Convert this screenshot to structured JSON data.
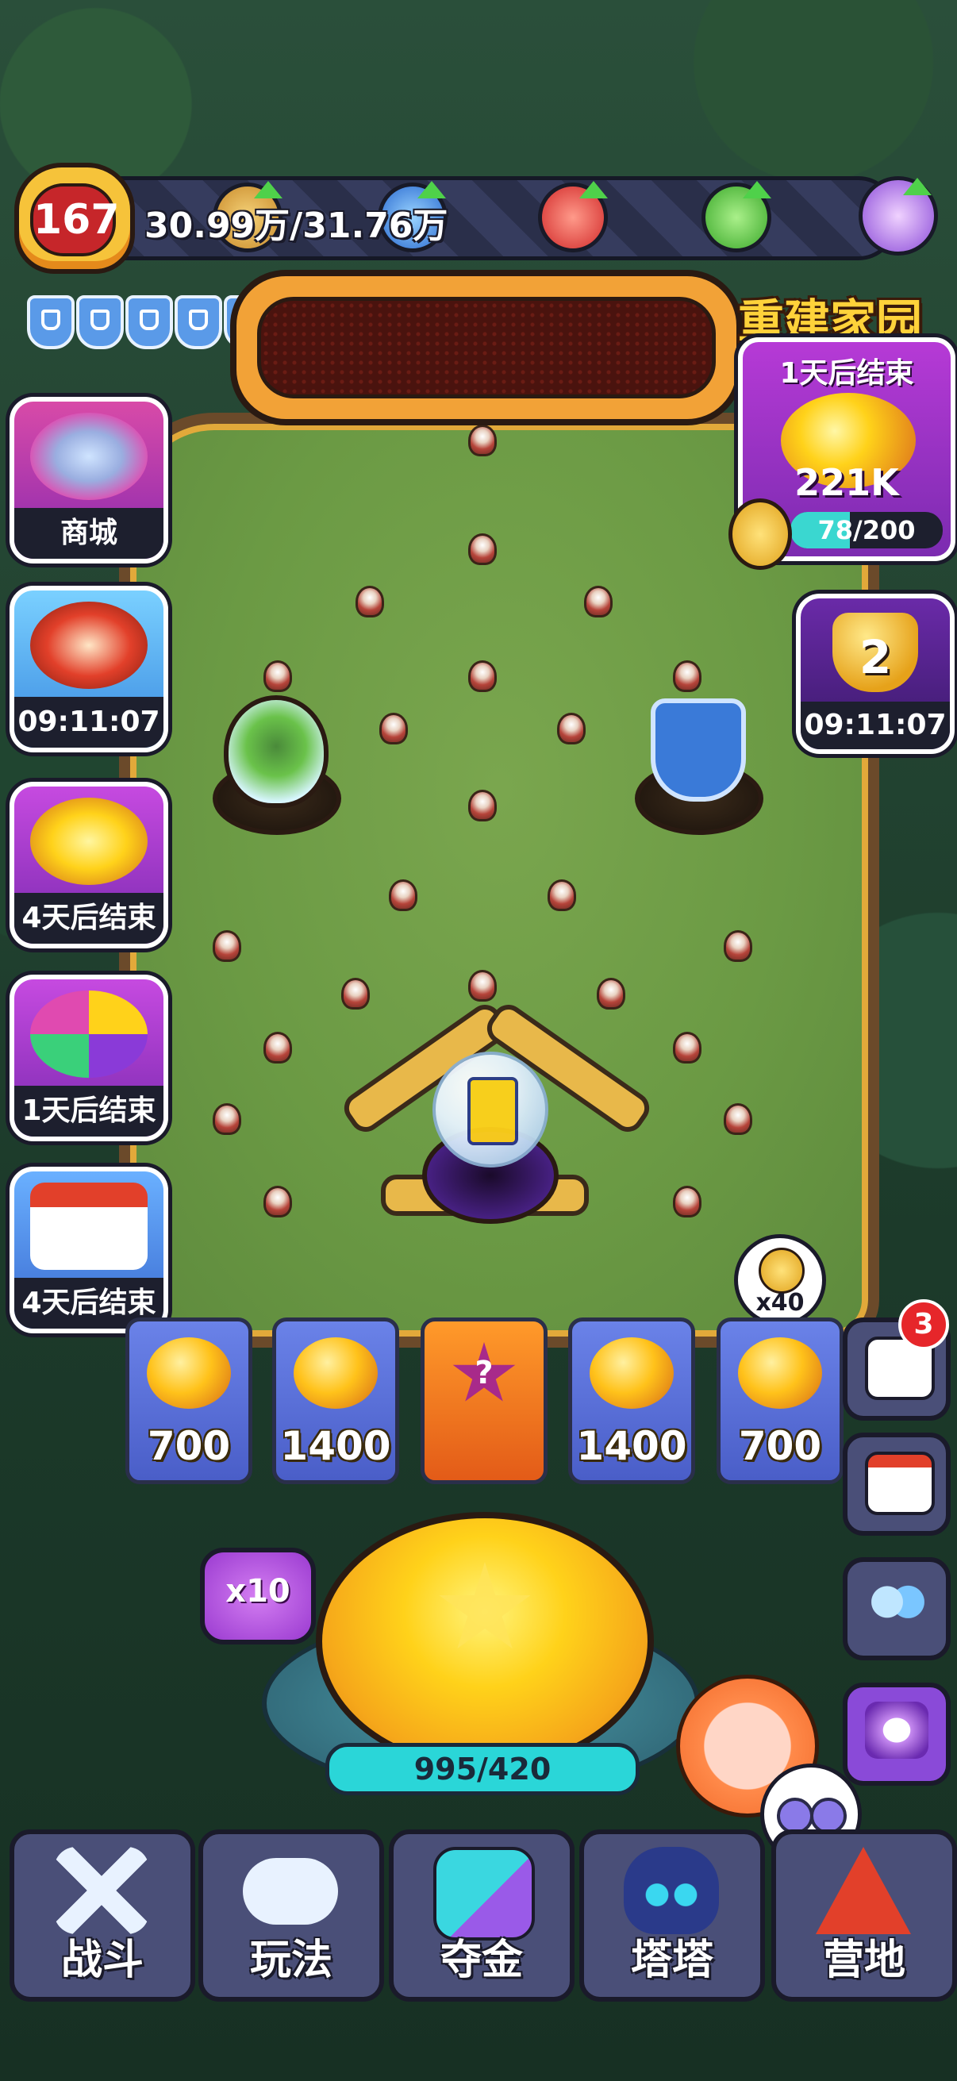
{
  "player": {
    "level": "167"
  },
  "resources": {
    "text": "30.99万/31.76万",
    "icons": [
      "gold-coin-icon",
      "blue-gem-icon",
      "red-fire-icon",
      "green-leaf-icon",
      "purple-orb-icon"
    ],
    "upgrade_arrow_color": "#4fd14a"
  },
  "shields": {
    "count": 5,
    "icon": "shield-icon",
    "color": "#5a9ae8"
  },
  "marquee": {
    "text": ""
  },
  "rebuild_event": {
    "title": "重建家园",
    "timer": "1天后结束",
    "reward": "221K",
    "progress_text": "78/200",
    "progress": 0.39
  },
  "trophy_event": {
    "count": "2",
    "timer": "09:11:07"
  },
  "left_events": [
    {
      "label": "商城",
      "icon": "shop-basket-icon"
    },
    {
      "label": "09:11:07",
      "icon": "red-bird-icon"
    },
    {
      "label": "4天后结束",
      "icon": "gold-cat-icon"
    },
    {
      "label": "1天后结束",
      "icon": "wheel-icon"
    },
    {
      "label": "4天后结束",
      "icon": "calendar-7-icon"
    }
  ],
  "prize_slots": [
    {
      "value": "700",
      "icon": "gold-pile-icon"
    },
    {
      "value": "1400",
      "icon": "gold-pile-icon"
    },
    {
      "value": "",
      "icon": "mystery-star-icon"
    },
    {
      "value": "1400",
      "icon": "gold-pile-icon"
    },
    {
      "value": "700",
      "icon": "gold-pile-icon"
    }
  ],
  "multiplier_bubble": {
    "text": "x40"
  },
  "chat": {
    "badge": "3"
  },
  "launcher": {
    "multiplier": "x10",
    "energy": "995/420"
  },
  "nav": [
    {
      "label": "战斗",
      "icon": "crossed-swords-icon"
    },
    {
      "label": "玩法",
      "icon": "gamepad-icon"
    },
    {
      "label": "夺金",
      "icon": "dice-cube-icon"
    },
    {
      "label": "塔塔",
      "icon": "cat-mascot-icon"
    },
    {
      "label": "营地",
      "icon": "tent-icon"
    }
  ],
  "colors": {
    "field_green": "#6b9a44",
    "gold": "#ffd21a",
    "panel_purple": "#7b2bb0",
    "nav_bg": "#4a4f78",
    "energy_bar": "#2ad6d8"
  }
}
